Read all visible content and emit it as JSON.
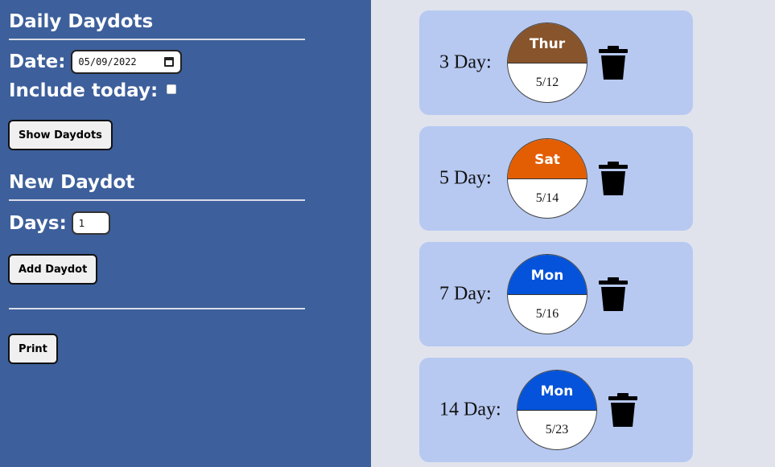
{
  "sidebar": {
    "daily_title": "Daily Daydots",
    "date_label": "Date:",
    "date_value": "05/09/2022",
    "include_today_label": "Include today:",
    "include_today_checked": false,
    "show_button": "Show Daydots",
    "new_title": "New Daydot",
    "days_label": "Days:",
    "days_value": "1",
    "add_button": "Add Daydot",
    "print_button": "Print"
  },
  "daydots": [
    {
      "label": "3 Day:",
      "day": "Thur",
      "date": "5/12",
      "color": "#87542b"
    },
    {
      "label": "5 Day:",
      "day": "Sat",
      "date": "5/14",
      "color": "#e35e03"
    },
    {
      "label": "7 Day:",
      "day": "Mon",
      "date": "5/16",
      "color": "#0453da"
    },
    {
      "label": "14 Day:",
      "day": "Mon",
      "date": "5/23",
      "color": "#0453da"
    }
  ],
  "icons": {
    "delete": "trash-icon",
    "calendar": "calendar-icon"
  }
}
